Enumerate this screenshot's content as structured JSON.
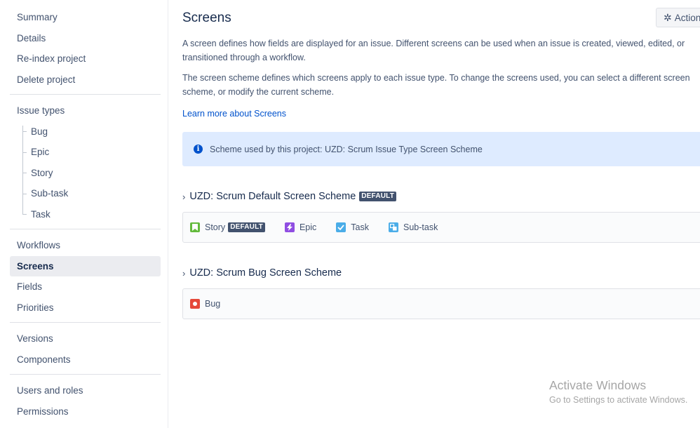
{
  "sidebar": {
    "group1": [
      "Summary",
      "Details",
      "Re-index project",
      "Delete project"
    ],
    "issue_types_label": "Issue types",
    "issue_types": [
      "Bug",
      "Epic",
      "Story",
      "Sub-task",
      "Task"
    ],
    "group3": [
      "Workflows",
      "Screens",
      "Fields",
      "Priorities"
    ],
    "active": "Screens",
    "group4": [
      "Versions",
      "Components"
    ],
    "group5": [
      "Users and roles",
      "Permissions"
    ]
  },
  "header": {
    "title": "Screens",
    "actions_label": "Actions"
  },
  "content": {
    "para1_line1": "A screen defines how fields are displayed for an issue. Different screens can be used when an issue is created, viewed, edited, or",
    "para1_line2": "transitioned through a workflow.",
    "para2_line1": "The screen scheme defines which screens apply to each issue type. To change the screens used, you can select a different screen",
    "para2_line2": "scheme, or modify the current scheme.",
    "learn_more": "Learn more about Screens",
    "info_text": "Scheme used by this project: UZD: Scrum Issue Type Screen Scheme"
  },
  "schemes": [
    {
      "title": "UZD: Scrum Default Screen Scheme",
      "badge": "DEFAULT",
      "types": [
        {
          "label": "Story",
          "icon": "story-icon",
          "badge": "DEFAULT"
        },
        {
          "label": "Epic",
          "icon": "epic-icon"
        },
        {
          "label": "Task",
          "icon": "task-icon"
        },
        {
          "label": "Sub-task",
          "icon": "subtask-icon"
        }
      ]
    },
    {
      "title": "UZD: Scrum Bug Screen Scheme",
      "types": [
        {
          "label": "Bug",
          "icon": "bug-icon"
        }
      ]
    }
  ],
  "watermark": {
    "title": "Activate Windows",
    "subtitle": "Go to Settings to activate Windows."
  },
  "colors": {
    "link": "#0052cc",
    "info_bg": "#deebff",
    "lozenge": "#42526e",
    "story": "#63ba3c",
    "epic": "#904ee2",
    "task": "#4bade8",
    "bug": "#e5493a"
  }
}
